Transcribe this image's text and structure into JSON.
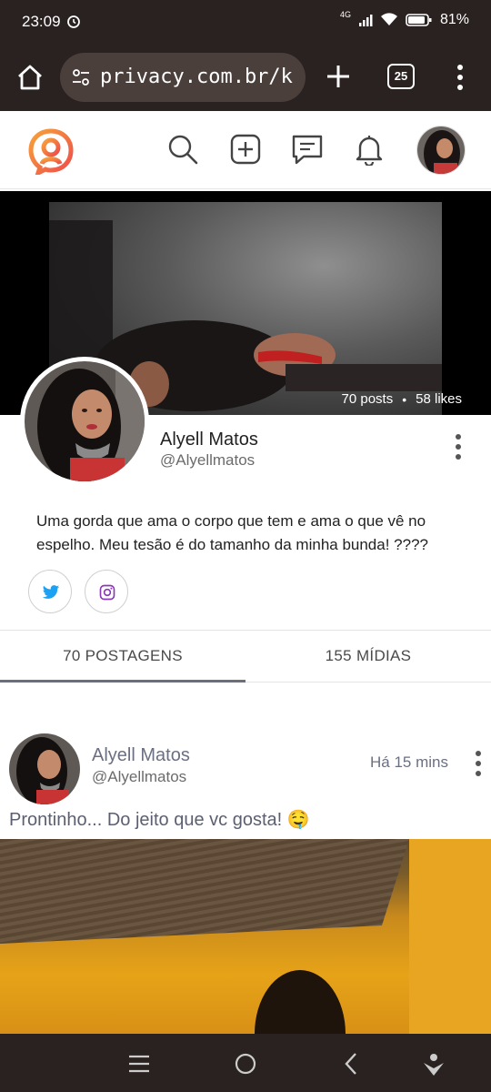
{
  "status_bar": {
    "time": "23:09",
    "network": "4G",
    "battery": "81%"
  },
  "browser": {
    "url": "privacy.com.br/k",
    "tab_count": "25"
  },
  "profile": {
    "posts_stat": "70 posts",
    "likes_stat": "58 likes",
    "name": "Alyell Matos",
    "handle": "@Alyellmatos",
    "bio": "Uma gorda que ama o corpo que tem e ama o que vê no espelho. Meu tesão é do tamanho da minha bunda! ????"
  },
  "tabs": [
    {
      "label": "70 POSTAGENS",
      "active": true
    },
    {
      "label": "155 MÍDIAS",
      "active": false
    }
  ],
  "post": {
    "author_name": "Alyell Matos",
    "author_handle": "@Alyellmatos",
    "time": "Há 15 mins",
    "text": "Prontinho... Do jeito que vc gosta! 🤤"
  },
  "colors": {
    "brand": "#f26b3a",
    "browser_bg": "#2a2220",
    "tab_underline": "#6a6f7c",
    "twitter": "#1da1f2",
    "instagram": "#8a3ab9"
  }
}
